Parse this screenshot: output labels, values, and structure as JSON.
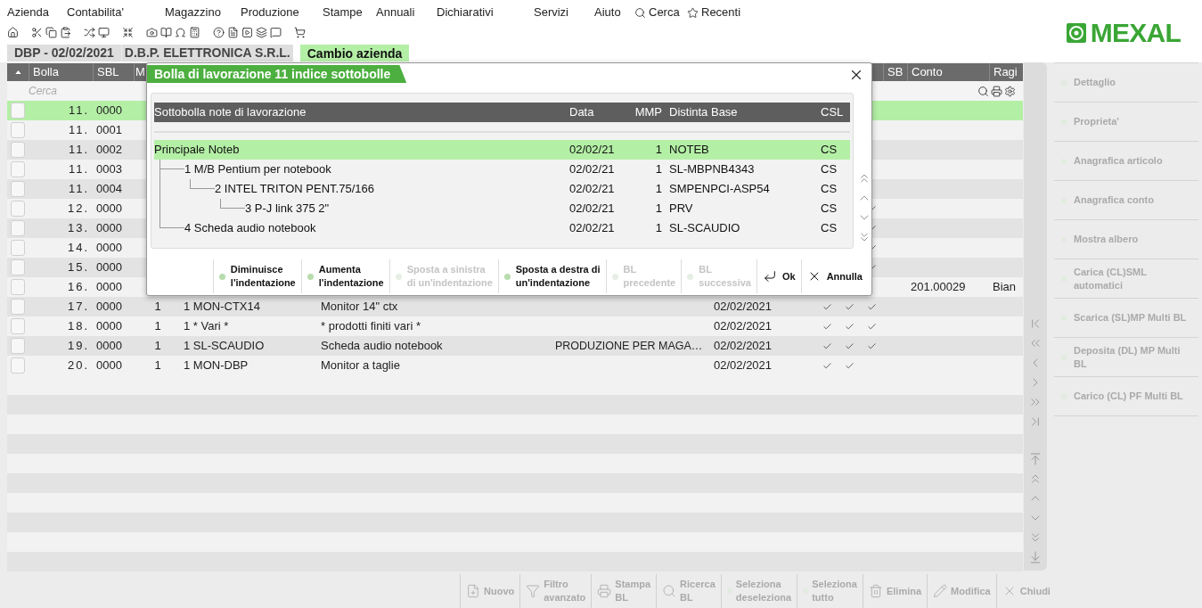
{
  "menu": [
    {
      "label": "Azienda"
    },
    {
      "label": "Contabilita'"
    },
    {
      "label": "Magazzino"
    },
    {
      "label": "Produzione"
    },
    {
      "label": "Stampe"
    },
    {
      "label": "Annuali"
    },
    {
      "label": "Dichiarativi"
    },
    {
      "label": "Servizi"
    },
    {
      "label": "Aiuto"
    },
    {
      "label": "Cerca",
      "kind": "search"
    },
    {
      "label": "Recenti",
      "kind": "star"
    }
  ],
  "logo": "MEXAL",
  "company_bar": {
    "code": "DBP - 02/02/2021",
    "name": "D.B.P. ELETTRONICA S.R.L.",
    "button": "Cambio azienda"
  },
  "table": {
    "columns": [
      {
        "label": "Bolla"
      },
      {
        "label": "SBL"
      },
      {
        "label": "M"
      },
      {
        "label": "SB"
      },
      {
        "label": "Conto"
      },
      {
        "label": "Ragi"
      }
    ],
    "search_placeholder": "Cerca",
    "rows": [
      {
        "bolla": "11.",
        "sbl": "0000",
        "selected": true,
        "checks": [
          false,
          false,
          false
        ]
      },
      {
        "bolla": "11.",
        "sbl": "0001",
        "selected": false,
        "checks": [
          false,
          false,
          false
        ]
      },
      {
        "bolla": "11.",
        "sbl": "0002",
        "selected": false,
        "checks": [
          false,
          false,
          false
        ]
      },
      {
        "bolla": "11.",
        "sbl": "0003",
        "selected": false,
        "checks": [
          false,
          false,
          false
        ]
      },
      {
        "bolla": "11.",
        "sbl": "0004",
        "selected": false,
        "checks": [
          false,
          false,
          false
        ]
      },
      {
        "bolla": "12.",
        "sbl": "0000",
        "selected": false,
        "checks": [
          false,
          false,
          true
        ]
      },
      {
        "bolla": "13.",
        "sbl": "0000",
        "selected": false,
        "checks": [
          false,
          false,
          true
        ]
      },
      {
        "bolla": "14.",
        "sbl": "0000",
        "selected": false,
        "checks": [
          false,
          false,
          true
        ]
      },
      {
        "bolla": "15.",
        "sbl": "0000",
        "selected": false,
        "checks": [
          false,
          false,
          true
        ]
      },
      {
        "bolla": "16.",
        "sbl": "0000",
        "selected": false,
        "checks": [
          false,
          false,
          false
        ],
        "conto": "201.00029",
        "ragi": "Bian"
      },
      {
        "bolla": "17.",
        "sbl": "0000",
        "m": "1",
        "articolo": "1 MON-CTX14",
        "descrizione": "Monitor 14\" ctx",
        "data": "02/02/2021",
        "selected": false,
        "checks": [
          true,
          true,
          true
        ]
      },
      {
        "bolla": "18.",
        "sbl": "0000",
        "m": "1",
        "articolo": "1 * Vari *",
        "descrizione": "* prodotti finiti vari *",
        "data": "02/02/2021",
        "selected": false,
        "checks": [
          true,
          true,
          true
        ]
      },
      {
        "bolla": "19.",
        "sbl": "0000",
        "m": "1",
        "articolo": "1 SL-SCAUDIO",
        "descrizione": "Scheda audio notebook",
        "note": "PRODUZIONE PER MAGA…",
        "data": "02/02/2021",
        "selected": false,
        "checks": [
          true,
          true,
          true
        ]
      },
      {
        "bolla": "20.",
        "sbl": "0000",
        "m": "1",
        "articolo": "1 MON-DBP",
        "descrizione": "Monitor a taglie",
        "data": "02/02/2021",
        "selected": false,
        "checks": [
          true,
          true,
          false
        ]
      }
    ]
  },
  "side_actions": [
    {
      "label": "Dettaglio",
      "disabled": true
    },
    {
      "label": "Proprieta'",
      "disabled": true
    },
    {
      "label": "Anagrafica articolo",
      "disabled": true
    },
    {
      "label": "Anagrafica conto",
      "disabled": true
    },
    {
      "label": "Mostra albero",
      "disabled": true
    },
    {
      "label": "Carica (CL)SML automatici",
      "disabled": true
    },
    {
      "label": "Scarica (SL)MP Multi BL",
      "disabled": true
    },
    {
      "label": "Deposita (DL) MP Multi BL",
      "disabled": true
    },
    {
      "label": "Carico (CL) PF Multi BL",
      "disabled": true
    }
  ],
  "bottom_toolbar": [
    {
      "label": "Nuovo",
      "kind": "new",
      "disabled": true
    },
    {
      "label": "Filtro\navanzato",
      "kind": "filter",
      "disabled": true
    },
    {
      "label": "Stampa\nBL",
      "kind": "print",
      "disabled": true
    },
    {
      "label": "Ricerca\nBL",
      "kind": "search",
      "disabled": true
    },
    {
      "label": "Seleziona\ndeseleziona",
      "kind": "dot",
      "disabled": true
    },
    {
      "label": "Seleziona\ntutto",
      "kind": "dot",
      "disabled": true
    },
    {
      "label": "Elimina",
      "kind": "delete",
      "disabled": true
    },
    {
      "label": "Modifica",
      "kind": "edit",
      "disabled": true
    },
    {
      "label": "Chiudi",
      "kind": "close",
      "disabled": true
    }
  ],
  "dialog": {
    "title": "Bolla di lavorazione 11 indice sottobolle",
    "columns": [
      {
        "label": "Sottobolla note di lavorazione"
      },
      {
        "label": "Data"
      },
      {
        "label": "MMP"
      },
      {
        "label": "Distinta Base"
      },
      {
        "label": "CSL"
      }
    ],
    "tree": [
      {
        "name": "Principale Noteb",
        "data": "02/02/21",
        "mmp": "1",
        "distinta": "NOTEB",
        "csl": "CS",
        "selected": true,
        "children": [
          {
            "name": "1 M/B Pentium per notebook",
            "data": "02/02/21",
            "mmp": "1",
            "distinta": "SL-MBPNB4343",
            "csl": "CS",
            "selected": false,
            "children": [
              {
                "name": "2 INTEL TRITON PENT.75/166",
                "data": "02/02/21",
                "mmp": "1",
                "distinta": "SMPENPCI-ASP54",
                "csl": "CS",
                "selected": false,
                "children": [
                  {
                    "name": "3 P-J link 375 2\"",
                    "data": "02/02/21",
                    "mmp": "1",
                    "distinta": "PRV",
                    "csl": "CS",
                    "selected": false
                  }
                ]
              }
            ]
          },
          {
            "name": "4 Scheda audio notebook",
            "data": "02/02/21",
            "mmp": "1",
            "distinta": "SL-SCAUDIO",
            "csl": "CS",
            "selected": false
          }
        ]
      }
    ],
    "buttons": [
      {
        "label": "Diminuisce\nl'indentazione",
        "kind": "dot",
        "disabled": false
      },
      {
        "label": "Aumenta\nl'indentazione",
        "kind": "dot",
        "disabled": false
      },
      {
        "label": "Sposta a sinistra\ndi un'indentazione",
        "kind": "dot",
        "disabled": true
      },
      {
        "label": "Sposta a destra di\nun'indentazione",
        "kind": "dot",
        "disabled": false
      },
      {
        "label": "BL\nprecedente",
        "kind": "dot",
        "disabled": true
      },
      {
        "label": "BL\nsuccessiva",
        "kind": "dot",
        "disabled": true
      },
      {
        "label": "Ok",
        "kind": "ok",
        "disabled": false
      },
      {
        "label": "Annulla",
        "kind": "cancel",
        "disabled": false
      }
    ]
  }
}
